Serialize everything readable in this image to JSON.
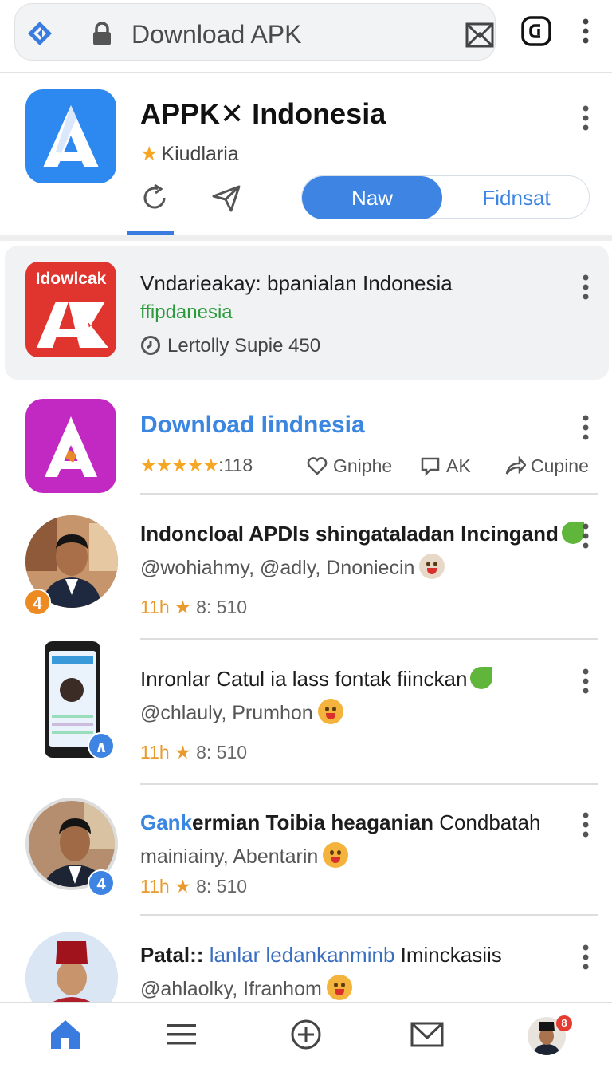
{
  "browser": {
    "url_text": "Download APK",
    "icons": [
      "site-diamond-icon",
      "lock-icon",
      "bookmark-save-icon",
      "tabs-icon",
      "more-vertical-icon"
    ]
  },
  "header": {
    "title": "APPK✕ Indonesia",
    "subtitle": "Kiudlaria",
    "toggle": {
      "option_a": "Naw",
      "option_b": "Fidnsat",
      "selected": "Naw"
    },
    "accent_color": "#3d84e3"
  },
  "featured": {
    "logo_text": "Idowlcak",
    "title": "Vndarieakay: bpanialan Indonesia",
    "subtitle": "ffipdanesia",
    "meta": "Lertolly Supie 450"
  },
  "app_item": {
    "title": "Download Iindnesia",
    "rating_stars": "★★★★★",
    "rating_count": ":118",
    "actions": {
      "like": "Gnіphe",
      "comment": "AK",
      "share": "Cupine"
    }
  },
  "posts": [
    {
      "title": "Indoncloal APDIs shingataladan Incingand",
      "handles": "@wohiahmy, @adly, Dnoniecin",
      "time": "11h",
      "score": "8: 510",
      "badge": "4"
    },
    {
      "title": "Inronlar Catul ia lass fontak fiinckan",
      "handles": "@chlauly, Prumhon",
      "time": "11h",
      "score": "8: 510",
      "badge": "∧"
    },
    {
      "title_highlight": "Gank",
      "title_bold": "ermian Toibia heaganian",
      "title_rest": " Condbatah",
      "handles": "mainiainy, Abentarin",
      "time": "11h",
      "score": "8: 510",
      "badge": "4"
    },
    {
      "title_bold": "Patal::",
      "title_rest": " lanlar ledankanminb",
      "title_tail": " Iminckasiis",
      "handles": "@ahlaolky, Ifranhom"
    }
  ],
  "bottom_nav": [
    "home-icon",
    "menu-icon",
    "add-icon",
    "mail-icon",
    "profile-avatar"
  ],
  "profile_badge": "8"
}
